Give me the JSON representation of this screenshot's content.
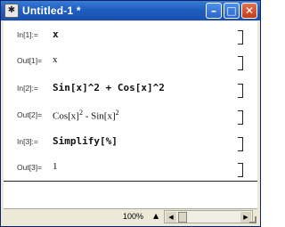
{
  "window": {
    "title": "Untitled-1 *",
    "app_icon": "mathematica-icon",
    "controls": {
      "minimize": "minimize-icon",
      "maximize": "maximize-icon",
      "close": "close-icon"
    }
  },
  "cells": [
    {
      "label": "In[1]:=",
      "expr": "x",
      "kind": "input"
    },
    {
      "label": "Out[1]=",
      "expr": "x",
      "kind": "output"
    },
    {
      "label": "In[2]:=",
      "expr": "Sin[x]^2 + Cos[x]^2",
      "kind": "input"
    },
    {
      "label": "Out[2]=",
      "expr_parts": [
        "Cos[x]",
        "2",
        " - Sin[x]",
        "2"
      ],
      "kind": "output"
    },
    {
      "label": "In[3]:=",
      "expr": "Simplify[%]",
      "kind": "input"
    },
    {
      "label": "Out[3]=",
      "expr": "1",
      "kind": "output"
    }
  ],
  "status_bar": {
    "zoom": "100%",
    "zoom_arrow_icon": "up-arrow-icon"
  }
}
